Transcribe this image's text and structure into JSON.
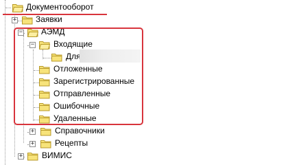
{
  "tree": {
    "root": {
      "label": "Документооборот",
      "expanded": true
    },
    "zayavki": {
      "label": "Заявки",
      "expanded": false
    },
    "aemd": {
      "label": "АЭМД",
      "expanded": true,
      "vhodyashchie": {
        "label": "Входящие",
        "expanded": true,
        "child_label": "Для"
      },
      "children": [
        "Отложенные",
        "Зарегистрированные",
        "Отправленные",
        "Ошибочные",
        "Удаленные"
      ]
    },
    "spravochniki": {
      "label": "Справочники",
      "expanded": false
    },
    "recepty": {
      "label": "Рецепты",
      "expanded": false
    },
    "vimis": {
      "label": "ВИМИС",
      "expanded": false
    }
  },
  "colors": {
    "highlight": "#d8343c",
    "folder_fill": "#f7e37a",
    "folder_stroke": "#b89a2a"
  }
}
